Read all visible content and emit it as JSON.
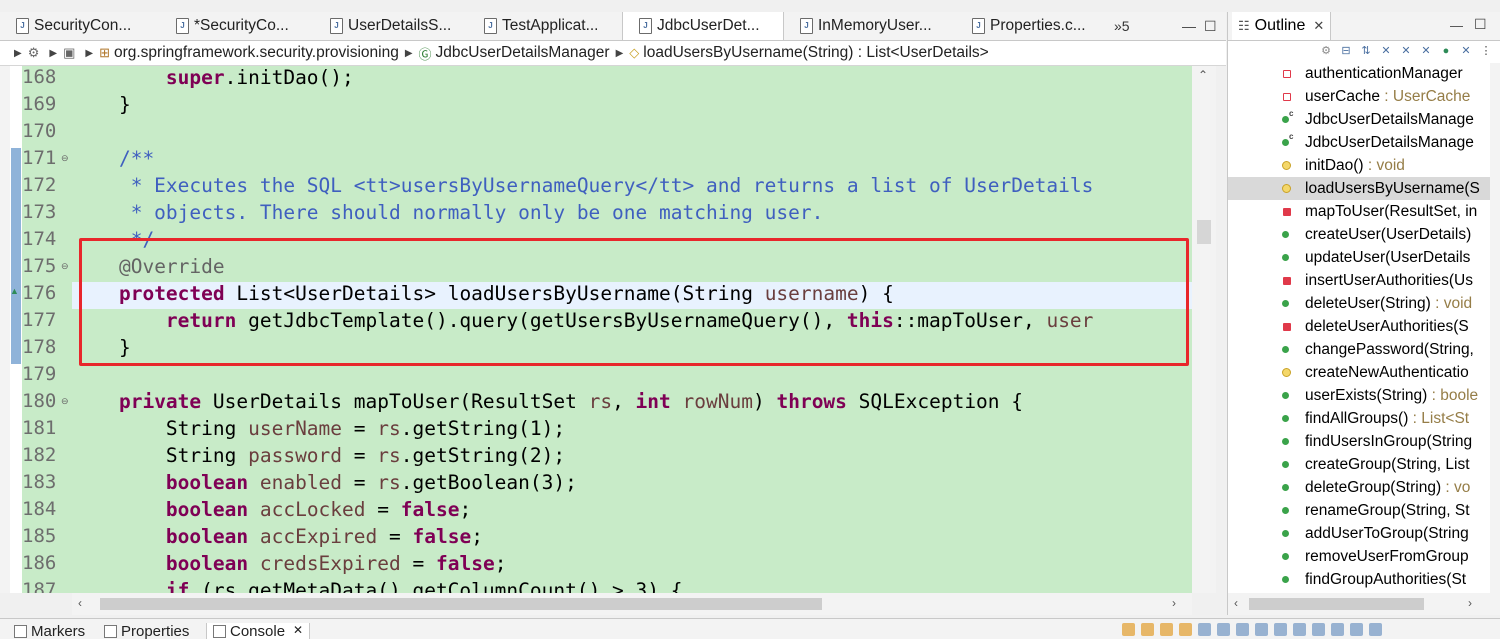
{
  "tabs": [
    {
      "label": "SecurityCon...",
      "active": false
    },
    {
      "label": "*SecurityCo...",
      "active": false
    },
    {
      "label": "UserDetailsS...",
      "active": false
    },
    {
      "label": "TestApplicat...",
      "active": false
    },
    {
      "label": "JdbcUserDet...",
      "active": true
    },
    {
      "label": "InMemoryUser...",
      "active": false
    },
    {
      "label": "Properties.c...",
      "active": false
    }
  ],
  "tab_overflow": "»5",
  "breadcrumb": {
    "package": "org.springframework.security.provisioning",
    "class": "JdbcUserDetailsManager",
    "method": "loadUsersByUsername(String) : List<UserDetails>"
  },
  "editor": {
    "line_numbers": [
      "168",
      "169",
      "170",
      "171",
      "172",
      "173",
      "174",
      "175",
      "176",
      "177",
      "178",
      "179",
      "180",
      "181",
      "182",
      "183",
      "184",
      "185",
      "186",
      "187"
    ],
    "lines": [
      [
        {
          "t": "        "
        },
        {
          "t": "super",
          "c": "kw"
        },
        {
          "t": ".initDao();"
        }
      ],
      [
        {
          "t": "    }"
        }
      ],
      [
        {
          "t": ""
        }
      ],
      [
        {
          "t": "    /**",
          "c": "cm"
        }
      ],
      [
        {
          "t": "     * Executes the SQL <tt>usersByUsernameQuery</tt> and returns a list of UserDetails",
          "c": "cm"
        }
      ],
      [
        {
          "t": "     * objects. There should normally only be one matching user.",
          "c": "cm"
        }
      ],
      [
        {
          "t": "     */",
          "c": "cm"
        }
      ],
      [
        {
          "t": "    "
        },
        {
          "t": "@Override",
          "c": "an"
        }
      ],
      [
        {
          "t": "    "
        },
        {
          "t": "protected",
          "c": "kw"
        },
        {
          "t": " List<UserDetails> loadUsersByUsername(String "
        },
        {
          "t": "username",
          "c": "fld"
        },
        {
          "t": ") {"
        }
      ],
      [
        {
          "t": "        "
        },
        {
          "t": "return",
          "c": "kw"
        },
        {
          "t": " getJdbcTemplate().query(getUsersByUsernameQuery(), "
        },
        {
          "t": "this",
          "c": "kw"
        },
        {
          "t": "::mapToUser, "
        },
        {
          "t": "user",
          "c": "fld"
        }
      ],
      [
        {
          "t": "    }"
        }
      ],
      [
        {
          "t": ""
        }
      ],
      [
        {
          "t": "    "
        },
        {
          "t": "private",
          "c": "kw"
        },
        {
          "t": " UserDetails mapToUser(ResultSet "
        },
        {
          "t": "rs",
          "c": "fld"
        },
        {
          "t": ", "
        },
        {
          "t": "int",
          "c": "kw"
        },
        {
          "t": " "
        },
        {
          "t": "rowNum",
          "c": "fld"
        },
        {
          "t": ") "
        },
        {
          "t": "throws",
          "c": "kw"
        },
        {
          "t": " SQLException {"
        }
      ],
      [
        {
          "t": "        String "
        },
        {
          "t": "userName",
          "c": "fld"
        },
        {
          "t": " = "
        },
        {
          "t": "rs",
          "c": "fld"
        },
        {
          "t": ".getString(1);"
        }
      ],
      [
        {
          "t": "        String "
        },
        {
          "t": "password",
          "c": "fld"
        },
        {
          "t": " = "
        },
        {
          "t": "rs",
          "c": "fld"
        },
        {
          "t": ".getString(2);"
        }
      ],
      [
        {
          "t": "        "
        },
        {
          "t": "boolean",
          "c": "kw"
        },
        {
          "t": " "
        },
        {
          "t": "enabled",
          "c": "fld"
        },
        {
          "t": " = "
        },
        {
          "t": "rs",
          "c": "fld"
        },
        {
          "t": ".getBoolean(3);"
        }
      ],
      [
        {
          "t": "        "
        },
        {
          "t": "boolean",
          "c": "kw"
        },
        {
          "t": " "
        },
        {
          "t": "accLocked",
          "c": "fld"
        },
        {
          "t": " = "
        },
        {
          "t": "false",
          "c": "kw"
        },
        {
          "t": ";"
        }
      ],
      [
        {
          "t": "        "
        },
        {
          "t": "boolean",
          "c": "kw"
        },
        {
          "t": " "
        },
        {
          "t": "accExpired",
          "c": "fld"
        },
        {
          "t": " = "
        },
        {
          "t": "false",
          "c": "kw"
        },
        {
          "t": ";"
        }
      ],
      [
        {
          "t": "        "
        },
        {
          "t": "boolean",
          "c": "kw"
        },
        {
          "t": " "
        },
        {
          "t": "credsExpired",
          "c": "fld"
        },
        {
          "t": " = "
        },
        {
          "t": "false",
          "c": "kw"
        },
        {
          "t": ";"
        }
      ],
      [
        {
          "t": "        "
        },
        {
          "t": "if",
          "c": "kw"
        },
        {
          "t": " (rs.getMetaData().getColumnCount() > 3) {"
        }
      ]
    ]
  },
  "outline": {
    "title": "Outline",
    "items": [
      {
        "name": "authenticationManager",
        "type": "",
        "vis": "private-field"
      },
      {
        "name": "userCache",
        "type": " : UserCache",
        "vis": "private-field"
      },
      {
        "name": "JdbcUserDetailsManage",
        "type": "",
        "vis": "public-ctor"
      },
      {
        "name": "JdbcUserDetailsManage",
        "type": "",
        "vis": "public-ctor"
      },
      {
        "name": "initDao()",
        "type": " : void",
        "vis": "protected-override"
      },
      {
        "name": "loadUsersByUsername(S",
        "type": "",
        "vis": "protected-override",
        "selected": true
      },
      {
        "name": "mapToUser(ResultSet, in",
        "type": "",
        "vis": "private"
      },
      {
        "name": "createUser(UserDetails)",
        "type": "",
        "vis": "public"
      },
      {
        "name": "updateUser(UserDetails",
        "type": "",
        "vis": "public"
      },
      {
        "name": "insertUserAuthorities(Us",
        "type": "",
        "vis": "private"
      },
      {
        "name": "deleteUser(String)",
        "type": " : void",
        "vis": "public"
      },
      {
        "name": "deleteUserAuthorities(S",
        "type": "",
        "vis": "private"
      },
      {
        "name": "changePassword(String,",
        "type": "",
        "vis": "public"
      },
      {
        "name": "createNewAuthenticatio",
        "type": "",
        "vis": "protected"
      },
      {
        "name": "userExists(String)",
        "type": " : boole",
        "vis": "public"
      },
      {
        "name": "findAllGroups()",
        "type": " : List<St",
        "vis": "public"
      },
      {
        "name": "findUsersInGroup(String",
        "type": "",
        "vis": "public"
      },
      {
        "name": "createGroup(String, List",
        "type": "",
        "vis": "public"
      },
      {
        "name": "deleteGroup(String)",
        "type": " : vo",
        "vis": "public"
      },
      {
        "name": "renameGroup(String, St",
        "type": "",
        "vis": "public"
      },
      {
        "name": "addUserToGroup(String",
        "type": "",
        "vis": "public"
      },
      {
        "name": "removeUserFromGroup",
        "type": "",
        "vis": "public"
      },
      {
        "name": "findGroupAuthorities(St",
        "type": "",
        "vis": "public"
      }
    ]
  },
  "bottom_tabs": [
    {
      "label": "Markers",
      "active": false
    },
    {
      "label": "Properties",
      "active": false
    },
    {
      "label": "Console",
      "active": true
    }
  ],
  "colors": {
    "editor_bg": "#c8ebc8",
    "keyword": "#7f0055",
    "comment": "#3f5fbf",
    "annotation": "#646464",
    "highlight_box": "#e8262b"
  }
}
